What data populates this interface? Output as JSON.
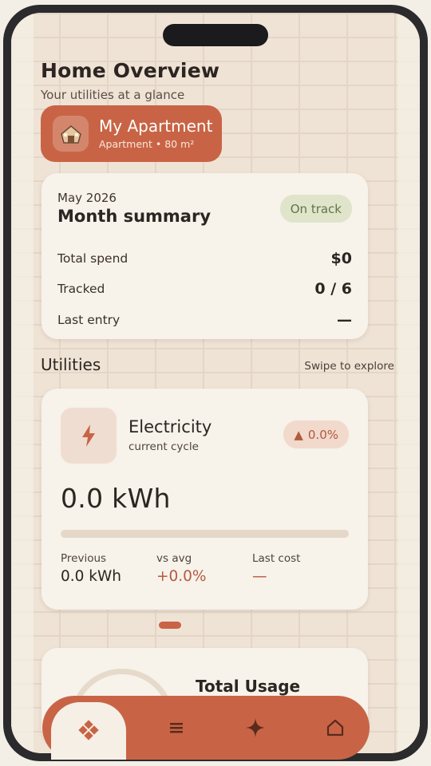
{
  "header": {
    "title": "Home Overview",
    "subtitle": "Your utilities at a glance"
  },
  "home": {
    "name": "My Apartment",
    "meta": "Apartment • 80 m²",
    "icon": "house-icon"
  },
  "summary": {
    "month": "May 2026",
    "title": "Month summary",
    "status": "On track",
    "rows": [
      {
        "label": "Total spend",
        "value": "$0"
      },
      {
        "label": "Tracked",
        "value": "0 / 6"
      },
      {
        "label": "Last entry",
        "value": "—"
      }
    ]
  },
  "utilities": {
    "title": "Utilities",
    "hint": "Swipe to explore",
    "electricity": {
      "name": "Electricity",
      "cycle": "current cycle",
      "trend": "0.0%",
      "usage": "0.0 kWh",
      "progress": 0,
      "stats": [
        {
          "label": "Previous",
          "value": "0.0 kWh"
        },
        {
          "label": "vs avg",
          "value": "+0.0%"
        },
        {
          "label": "Last cost",
          "value": "—"
        }
      ]
    },
    "total": {
      "title": "Total Usage"
    }
  },
  "nav": {
    "items": [
      "home-icon",
      "list-icon",
      "sparkle-icon",
      "house-outline-icon"
    ]
  },
  "colors": {
    "accent": "#c86445",
    "ok_bg": "#dfe4cb",
    "ok_text": "#607547",
    "background": "#efe3d6"
  }
}
